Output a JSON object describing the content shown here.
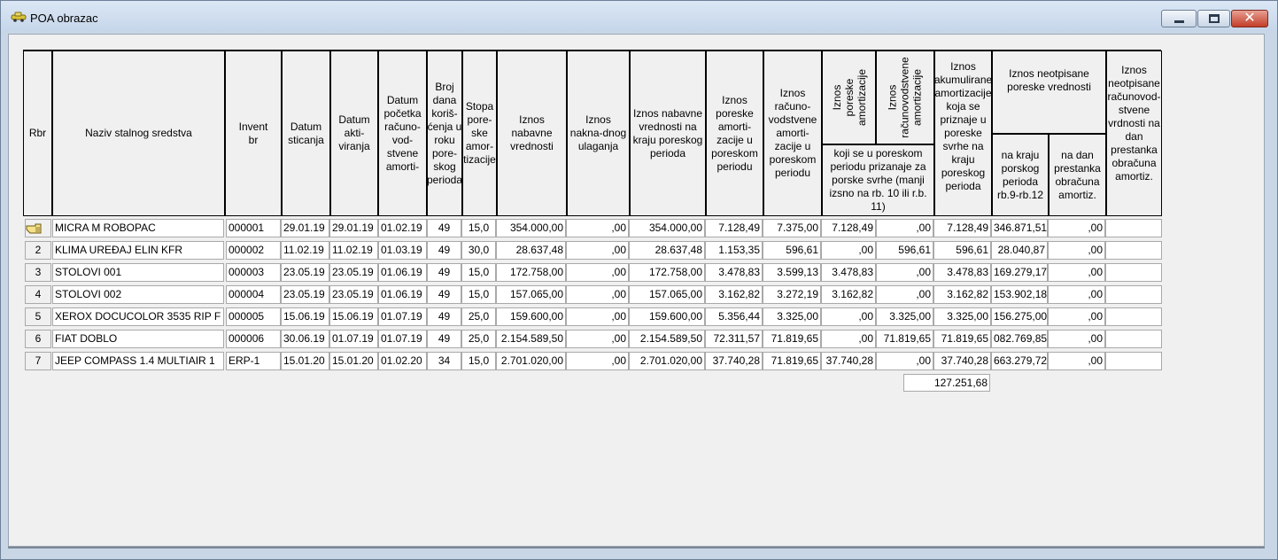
{
  "window": {
    "title": "POA obrazac"
  },
  "headers": {
    "rbr": "Rbr",
    "naziv": "Naziv stalnog sredstva",
    "invent": "Invent br",
    "datum_sticanja": "Datum sticanja",
    "datum_aktiviranja": "Datum akti-viranja",
    "datum_pocetka": "Datum početka računo-vod-stvene amorti-",
    "broj_dana": "Broj dana koriš-ćenja u roku pore-skog perioda",
    "stopa": "Stopa pore-ske amor-tizacije",
    "iznos_nabavne": "Iznos nabavne vrednosti",
    "iznos_naknadnog": "Iznos nakna-dnog ulaganja",
    "iznos_nab_kraj": "Iznos nabavne vrednosti na kraju poreskog perioda",
    "iznos_por_amort": "Iznos poreske amorti-zacije u poreskom periodu",
    "iznos_rac_amort": "Iznos računo-vodstvene amorti-zacije u poreskom periodu",
    "rot_poreske": "Iznos poreske amortizacije",
    "rot_racunovodstvene": "Iznos računovodstvene amortizacije",
    "koji_se": "koji se u poreskom periodu prizanaje za porske svrhe (manji izsno na rb. 10  ili r.b. 11)",
    "iznos_akumulirane": "Iznos akumulirane amortizacije koja se priznaje u poreske svrhe na kraju poreskog perioda",
    "neotpisane_group": "Iznos neotpisane poreske vrednosti",
    "na_kraju": "na kraju porskog perioda rb.9-rb.12",
    "na_dan": "na dan prestanka obračuna amortiz.",
    "iznos_neotp_prest": "Iznos neotpisane računovod-stvene vrdnosti na dan prestanka obračuna amortiz."
  },
  "rows": [
    {
      "rbr": "",
      "naziv": "MICRA M ROBOPAC",
      "invent": "000001",
      "sticanja": "29.01.19",
      "aktiviranja": "29.01.19",
      "pocetka": "01.02.19",
      "dana": "49",
      "stopa": "15,0",
      "nabavna": "354.000,00",
      "naknadno": ",00",
      "nab_kraj": "354.000,00",
      "por_amort": "7.128,49",
      "rac_amort": "7.375,00",
      "priznaje_por": "7.128,49",
      "priznaje_rac": ",00",
      "akumulirana": "7.128,49",
      "neotp_kraj": "346.871,51",
      "neotp_dan": ",00",
      "neotp_rac": ""
    },
    {
      "rbr": "2",
      "naziv": "KLIMA UREĐAJ ELIN KFR",
      "invent": "000002",
      "sticanja": "11.02.19",
      "aktiviranja": "11.02.19",
      "pocetka": "01.03.19",
      "dana": "49",
      "stopa": "30,0",
      "nabavna": "28.637,48",
      "naknadno": ",00",
      "nab_kraj": "28.637,48",
      "por_amort": "1.153,35",
      "rac_amort": "596,61",
      "priznaje_por": ",00",
      "priznaje_rac": "596,61",
      "akumulirana": "596,61",
      "neotp_kraj": "28.040,87",
      "neotp_dan": ",00",
      "neotp_rac": ""
    },
    {
      "rbr": "3",
      "naziv": "STOLOVI 001",
      "invent": "000003",
      "sticanja": "23.05.19",
      "aktiviranja": "23.05.19",
      "pocetka": "01.06.19",
      "dana": "49",
      "stopa": "15,0",
      "nabavna": "172.758,00",
      "naknadno": ",00",
      "nab_kraj": "172.758,00",
      "por_amort": "3.478,83",
      "rac_amort": "3.599,13",
      "priznaje_por": "3.478,83",
      "priznaje_rac": ",00",
      "akumulirana": "3.478,83",
      "neotp_kraj": "169.279,17",
      "neotp_dan": ",00",
      "neotp_rac": ""
    },
    {
      "rbr": "4",
      "naziv": "STOLOVI 002",
      "invent": "000004",
      "sticanja": "23.05.19",
      "aktiviranja": "23.05.19",
      "pocetka": "01.06.19",
      "dana": "49",
      "stopa": "15,0",
      "nabavna": "157.065,00",
      "naknadno": ",00",
      "nab_kraj": "157.065,00",
      "por_amort": "3.162,82",
      "rac_amort": "3.272,19",
      "priznaje_por": "3.162,82",
      "priznaje_rac": ",00",
      "akumulirana": "3.162,82",
      "neotp_kraj": "153.902,18",
      "neotp_dan": ",00",
      "neotp_rac": ""
    },
    {
      "rbr": "5",
      "naziv": "XEROX DOCUCOLOR 3535 RIP F",
      "invent": "000005",
      "sticanja": "15.06.19",
      "aktiviranja": "15.06.19",
      "pocetka": "01.07.19",
      "dana": "49",
      "stopa": "25,0",
      "nabavna": "159.600,00",
      "naknadno": ",00",
      "nab_kraj": "159.600,00",
      "por_amort": "5.356,44",
      "rac_amort": "3.325,00",
      "priznaje_por": ",00",
      "priznaje_rac": "3.325,00",
      "akumulirana": "3.325,00",
      "neotp_kraj": "156.275,00",
      "neotp_dan": ",00",
      "neotp_rac": ""
    },
    {
      "rbr": "6",
      "naziv": "FIAT DOBLO",
      "invent": "000006",
      "sticanja": "30.06.19",
      "aktiviranja": "01.07.19",
      "pocetka": "01.07.19",
      "dana": "49",
      "stopa": "25,0",
      "nabavna": "2.154.589,50",
      "naknadno": ",00",
      "nab_kraj": "2.154.589,50",
      "por_amort": "72.311,57",
      "rac_amort": "71.819,65",
      "priznaje_por": ",00",
      "priznaje_rac": "71.819,65",
      "akumulirana": "71.819,65",
      "neotp_kraj": "082.769,85",
      "neotp_dan": ",00",
      "neotp_rac": ""
    },
    {
      "rbr": "7",
      "naziv": "JEEP COMPASS 1.4 MULTIAIR 1",
      "invent": "ERP-1",
      "sticanja": "15.01.20",
      "aktiviranja": "15.01.20",
      "pocetka": "01.02.20",
      "dana": "34",
      "stopa": "15,0",
      "nabavna": "2.701.020,00",
      "naknadno": ",00",
      "nab_kraj": "2.701.020,00",
      "por_amort": "37.740,28",
      "rac_amort": "71.819,65",
      "priznaje_por": "37.740,28",
      "priznaje_rac": ",00",
      "akumulirana": "37.740,28",
      "neotp_kraj": "663.279,72",
      "neotp_dan": ",00",
      "neotp_rac": ""
    }
  ],
  "total": {
    "akumulirana": "127.251,68"
  },
  "icons": {
    "app": "car-icon",
    "pointer": "hand-pointer-icon",
    "minimize": "minimize-icon",
    "maximize": "maximize-icon",
    "close": "close-icon"
  }
}
